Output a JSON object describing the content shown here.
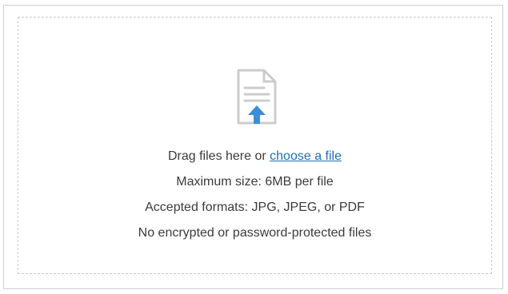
{
  "dropzone": {
    "drag_prefix": "Drag files here or ",
    "choose_link": "choose a file",
    "max_size": "Maximum size: 6MB per file",
    "formats": "Accepted formats: JPG, JPEG, or PDF",
    "restriction": "No encrypted or password-protected files",
    "icon": "file-upload-icon"
  },
  "colors": {
    "link": "#1f6fb3",
    "arrow": "#3b8fd9",
    "text": "#3b3b3b",
    "dashed_border": "#c9c9c9"
  }
}
